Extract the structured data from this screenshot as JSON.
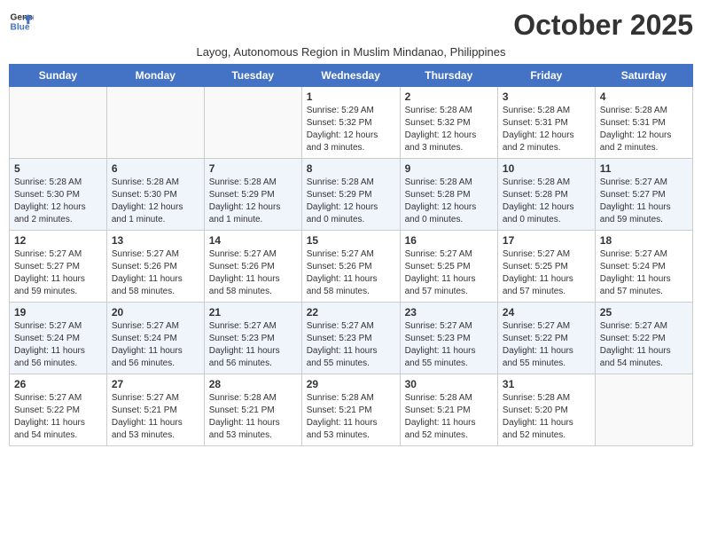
{
  "header": {
    "logo_line1": "General",
    "logo_line2": "Blue",
    "month_title": "October 2025",
    "subtitle": "Layog, Autonomous Region in Muslim Mindanao, Philippines"
  },
  "days_of_week": [
    "Sunday",
    "Monday",
    "Tuesday",
    "Wednesday",
    "Thursday",
    "Friday",
    "Saturday"
  ],
  "weeks": [
    [
      {
        "day": "",
        "info": ""
      },
      {
        "day": "",
        "info": ""
      },
      {
        "day": "",
        "info": ""
      },
      {
        "day": "1",
        "info": "Sunrise: 5:29 AM\nSunset: 5:32 PM\nDaylight: 12 hours\nand 3 minutes."
      },
      {
        "day": "2",
        "info": "Sunrise: 5:28 AM\nSunset: 5:32 PM\nDaylight: 12 hours\nand 3 minutes."
      },
      {
        "day": "3",
        "info": "Sunrise: 5:28 AM\nSunset: 5:31 PM\nDaylight: 12 hours\nand 2 minutes."
      },
      {
        "day": "4",
        "info": "Sunrise: 5:28 AM\nSunset: 5:31 PM\nDaylight: 12 hours\nand 2 minutes."
      }
    ],
    [
      {
        "day": "5",
        "info": "Sunrise: 5:28 AM\nSunset: 5:30 PM\nDaylight: 12 hours\nand 2 minutes."
      },
      {
        "day": "6",
        "info": "Sunrise: 5:28 AM\nSunset: 5:30 PM\nDaylight: 12 hours\nand 1 minute."
      },
      {
        "day": "7",
        "info": "Sunrise: 5:28 AM\nSunset: 5:29 PM\nDaylight: 12 hours\nand 1 minute."
      },
      {
        "day": "8",
        "info": "Sunrise: 5:28 AM\nSunset: 5:29 PM\nDaylight: 12 hours\nand 0 minutes."
      },
      {
        "day": "9",
        "info": "Sunrise: 5:28 AM\nSunset: 5:28 PM\nDaylight: 12 hours\nand 0 minutes."
      },
      {
        "day": "10",
        "info": "Sunrise: 5:28 AM\nSunset: 5:28 PM\nDaylight: 12 hours\nand 0 minutes."
      },
      {
        "day": "11",
        "info": "Sunrise: 5:27 AM\nSunset: 5:27 PM\nDaylight: 11 hours\nand 59 minutes."
      }
    ],
    [
      {
        "day": "12",
        "info": "Sunrise: 5:27 AM\nSunset: 5:27 PM\nDaylight: 11 hours\nand 59 minutes."
      },
      {
        "day": "13",
        "info": "Sunrise: 5:27 AM\nSunset: 5:26 PM\nDaylight: 11 hours\nand 58 minutes."
      },
      {
        "day": "14",
        "info": "Sunrise: 5:27 AM\nSunset: 5:26 PM\nDaylight: 11 hours\nand 58 minutes."
      },
      {
        "day": "15",
        "info": "Sunrise: 5:27 AM\nSunset: 5:26 PM\nDaylight: 11 hours\nand 58 minutes."
      },
      {
        "day": "16",
        "info": "Sunrise: 5:27 AM\nSunset: 5:25 PM\nDaylight: 11 hours\nand 57 minutes."
      },
      {
        "day": "17",
        "info": "Sunrise: 5:27 AM\nSunset: 5:25 PM\nDaylight: 11 hours\nand 57 minutes."
      },
      {
        "day": "18",
        "info": "Sunrise: 5:27 AM\nSunset: 5:24 PM\nDaylight: 11 hours\nand 57 minutes."
      }
    ],
    [
      {
        "day": "19",
        "info": "Sunrise: 5:27 AM\nSunset: 5:24 PM\nDaylight: 11 hours\nand 56 minutes."
      },
      {
        "day": "20",
        "info": "Sunrise: 5:27 AM\nSunset: 5:24 PM\nDaylight: 11 hours\nand 56 minutes."
      },
      {
        "day": "21",
        "info": "Sunrise: 5:27 AM\nSunset: 5:23 PM\nDaylight: 11 hours\nand 56 minutes."
      },
      {
        "day": "22",
        "info": "Sunrise: 5:27 AM\nSunset: 5:23 PM\nDaylight: 11 hours\nand 55 minutes."
      },
      {
        "day": "23",
        "info": "Sunrise: 5:27 AM\nSunset: 5:23 PM\nDaylight: 11 hours\nand 55 minutes."
      },
      {
        "day": "24",
        "info": "Sunrise: 5:27 AM\nSunset: 5:22 PM\nDaylight: 11 hours\nand 55 minutes."
      },
      {
        "day": "25",
        "info": "Sunrise: 5:27 AM\nSunset: 5:22 PM\nDaylight: 11 hours\nand 54 minutes."
      }
    ],
    [
      {
        "day": "26",
        "info": "Sunrise: 5:27 AM\nSunset: 5:22 PM\nDaylight: 11 hours\nand 54 minutes."
      },
      {
        "day": "27",
        "info": "Sunrise: 5:27 AM\nSunset: 5:21 PM\nDaylight: 11 hours\nand 53 minutes."
      },
      {
        "day": "28",
        "info": "Sunrise: 5:28 AM\nSunset: 5:21 PM\nDaylight: 11 hours\nand 53 minutes."
      },
      {
        "day": "29",
        "info": "Sunrise: 5:28 AM\nSunset: 5:21 PM\nDaylight: 11 hours\nand 53 minutes."
      },
      {
        "day": "30",
        "info": "Sunrise: 5:28 AM\nSunset: 5:21 PM\nDaylight: 11 hours\nand 52 minutes."
      },
      {
        "day": "31",
        "info": "Sunrise: 5:28 AM\nSunset: 5:20 PM\nDaylight: 11 hours\nand 52 minutes."
      },
      {
        "day": "",
        "info": ""
      }
    ]
  ]
}
